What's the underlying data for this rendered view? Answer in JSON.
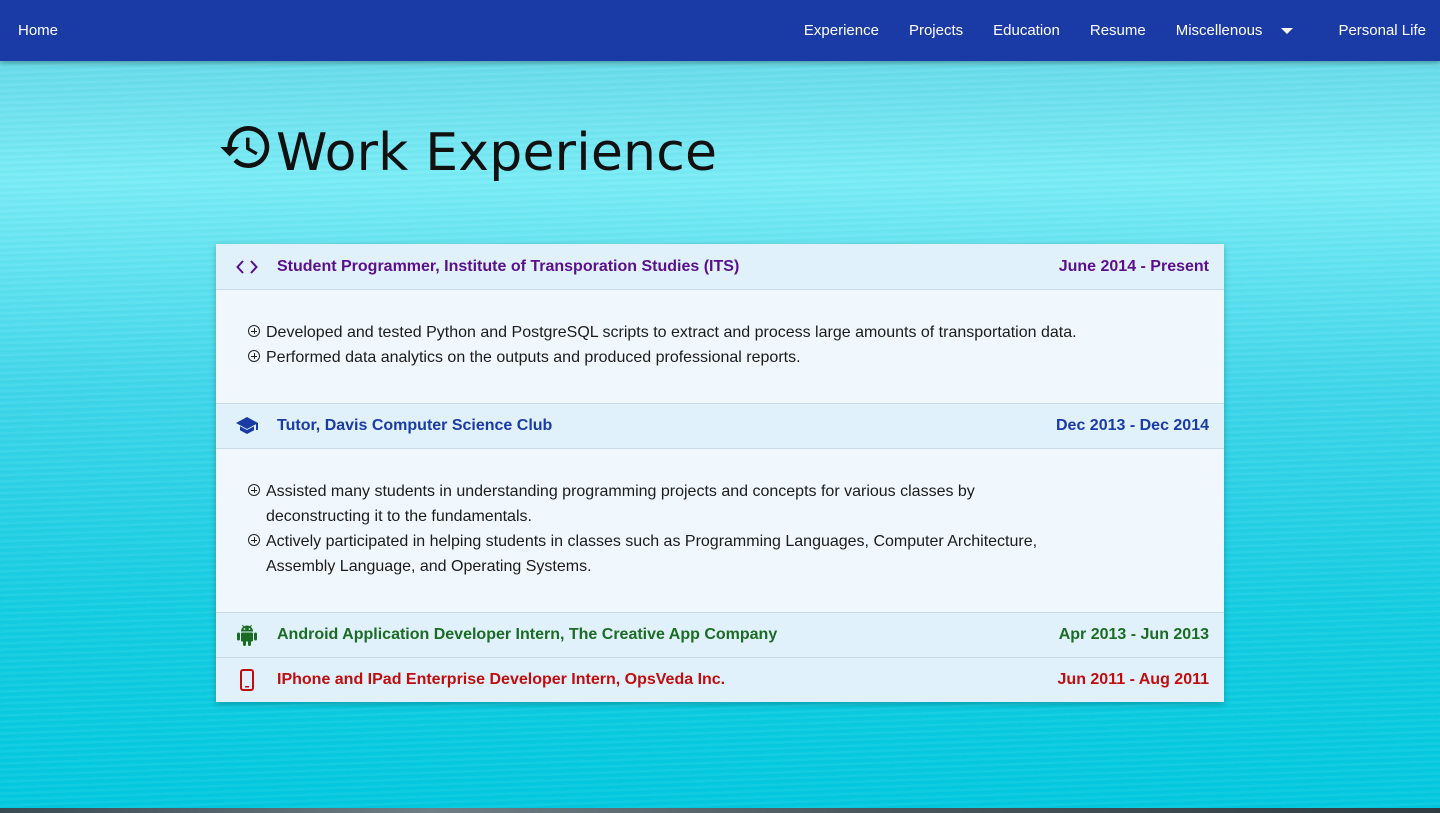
{
  "nav": {
    "home": "Home",
    "links": [
      "Experience",
      "Projects",
      "Education",
      "Resume"
    ],
    "dropdown": "Miscellenous",
    "last": "Personal Life"
  },
  "page": {
    "title": "Work Experience"
  },
  "colors": {
    "navbar": "#1a3aa6",
    "purple": "#5a0f8c",
    "blue": "#1a3aa6",
    "green": "#1a6b23",
    "red": "#c10d0d"
  },
  "jobs": [
    {
      "icon": "code-icon",
      "title": "Student Programmer, Institute of Transporation Studies (ITS)",
      "dates": "June 2014 - Present",
      "bullets": [
        "Developed and tested Python and PostgreSQL scripts to extract and process large amounts of transportation data.",
        "Performed data analytics on the outputs and produced professional reports."
      ]
    },
    {
      "icon": "graduation-cap-icon",
      "title": "Tutor, Davis Computer Science Club",
      "dates": "Dec 2013 - Dec 2014",
      "bullets": [
        "Assisted many students in understanding programming projects and concepts for various classes by deconstructing it to the fundamentals.",
        "Actively participated in helping students in classes such as Programming Languages, Computer Architecture, Assembly Language, and Operating Systems."
      ]
    },
    {
      "icon": "android-icon",
      "title": "Android Application Developer Intern, The Creative App Company",
      "dates": "Apr 2013 - Jun 2013"
    },
    {
      "icon": "phone-icon",
      "title": "IPhone and IPad Enterprise Developer Intern, OpsVeda Inc.",
      "dates": "Jun 2011 - Aug 2011"
    }
  ]
}
